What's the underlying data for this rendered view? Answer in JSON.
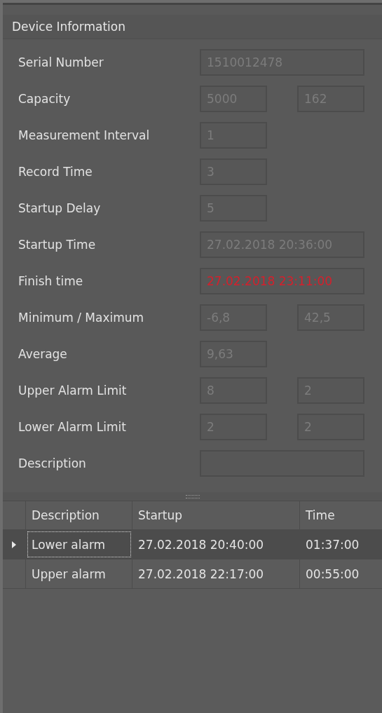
{
  "panel": {
    "title": "Device Information"
  },
  "fields": [
    {
      "label": "Serial Number",
      "kind": "wide",
      "values": [
        "1510012478"
      ]
    },
    {
      "label": "Capacity",
      "kind": "pair",
      "values": [
        "5000",
        "162"
      ]
    },
    {
      "label": "Measurement Interval",
      "kind": "narrow",
      "values": [
        "1"
      ]
    },
    {
      "label": "Record Time",
      "kind": "narrow",
      "values": [
        "3"
      ]
    },
    {
      "label": "Startup Delay",
      "kind": "narrow",
      "values": [
        "5"
      ]
    },
    {
      "label": "Startup Time",
      "kind": "wide",
      "values": [
        "27.02.2018 20:36:00"
      ]
    },
    {
      "label": "Finish time",
      "kind": "wide",
      "alert": true,
      "values": [
        "27.02.2018 23:11:00"
      ]
    },
    {
      "label": "Minimum / Maximum",
      "kind": "pair",
      "values": [
        "-6,8",
        "42,5"
      ]
    },
    {
      "label": "Average",
      "kind": "narrow",
      "values": [
        "9,63"
      ]
    },
    {
      "label": "Upper Alarm Limit",
      "kind": "pair",
      "values": [
        "8",
        "2"
      ]
    },
    {
      "label": "Lower Alarm Limit",
      "kind": "pair",
      "values": [
        "2",
        "2"
      ]
    },
    {
      "label": "Description",
      "kind": "wide"
    }
  ],
  "table": {
    "columns": [
      "Description",
      "Startup",
      "Time"
    ],
    "rows": [
      {
        "selected": true,
        "cells": [
          "Lower alarm",
          "27.02.2018 20:40:00",
          "01:37:00"
        ]
      },
      {
        "selected": false,
        "cells": [
          "Upper alarm",
          "27.02.2018 22:17:00",
          "00:55:00"
        ]
      }
    ]
  }
}
